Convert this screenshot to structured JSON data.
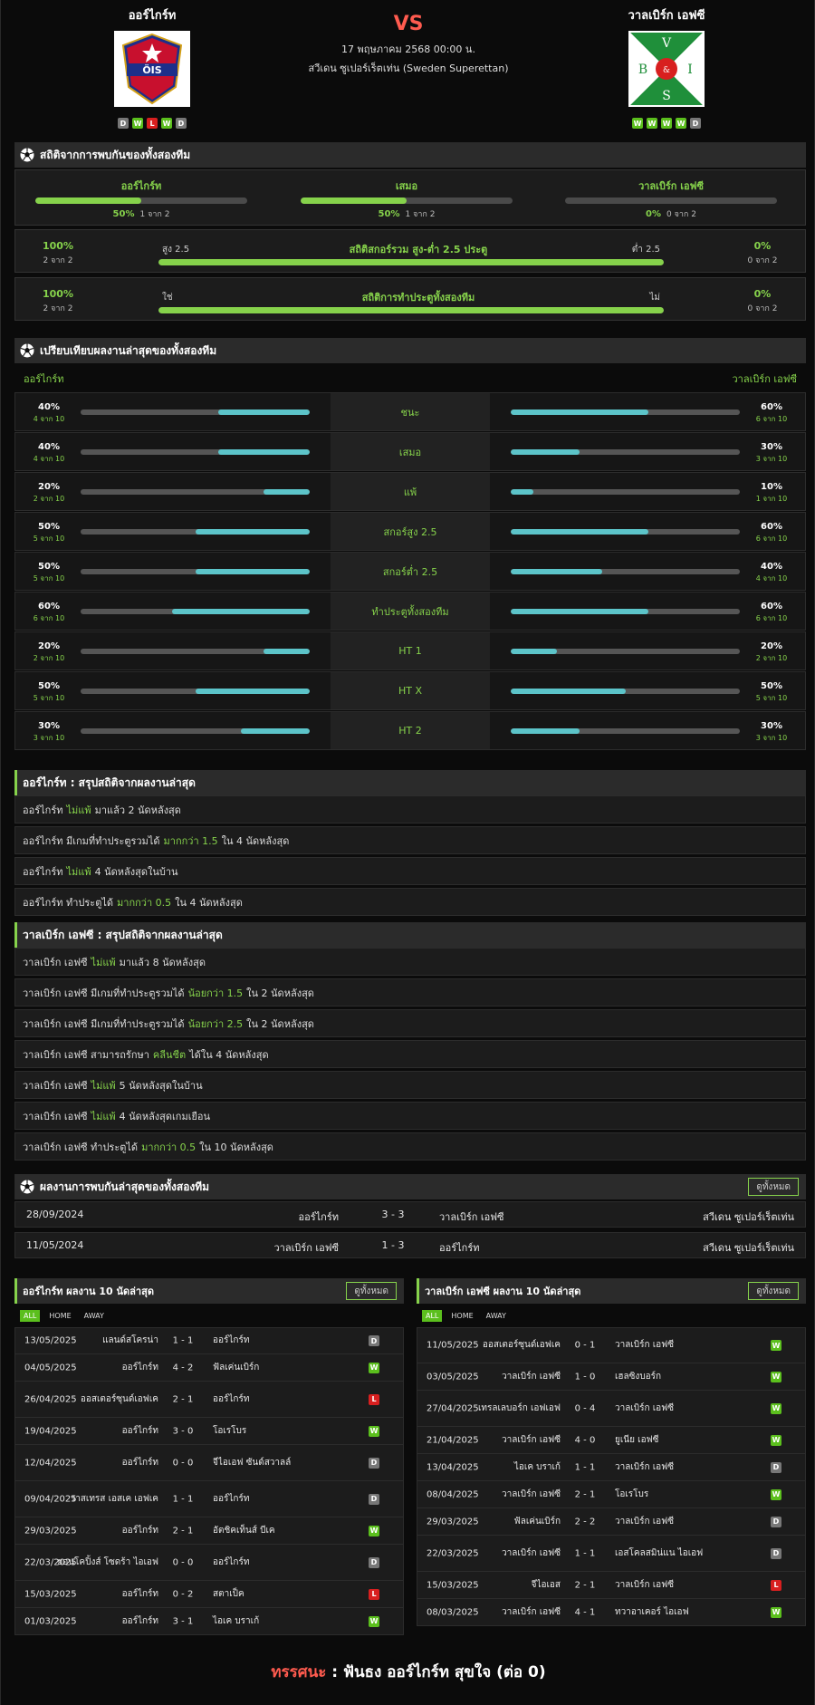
{
  "header": {
    "home_team": "ออร์ไกร์ท",
    "away_team": "วาลเบิร์ก เอฟซี",
    "vs": "VS",
    "date": "17 พฤษภาคม 2568 00:00 น.",
    "league": "สวีเดน ซูเปอร์เร็ตเท่น (Sweden Superettan)",
    "home_logo_text": "ÖIS",
    "away_logo_letters": [
      "V",
      "B",
      "&",
      "I",
      "S"
    ],
    "home_form": [
      "D",
      "W",
      "L",
      "W",
      "D"
    ],
    "away_form": [
      "W",
      "W",
      "W",
      "W",
      "D"
    ]
  },
  "h2h_stats": {
    "title": "สถิติจากการพบกันของทั้งสองทีม",
    "cells": [
      {
        "label": "ออร์ไกร์ท",
        "pct": "50%",
        "count": "1 จาก 2",
        "fill": 0.5
      },
      {
        "label": "เสมอ",
        "pct": "50%",
        "count": "1 จาก 2",
        "fill": 0.5
      },
      {
        "label": "วาลเบิร์ก เอฟซี",
        "pct": "0%",
        "count": "0 จาก 2",
        "fill": 0
      }
    ],
    "ou": {
      "title": "สถิติสกอร์รวม สูง-ต่ำ 2.5 ประตู",
      "left_label": "สูง 2.5",
      "right_label": "ต่ำ 2.5",
      "left_pct": "100%",
      "left_count": "2 จาก 2",
      "right_pct": "0%",
      "right_count": "0 จาก 2",
      "fill": 1
    },
    "btts": {
      "title": "สถิติการทำประตูทั้งสองทีม",
      "left_label": "ใช่",
      "right_label": "ไม่",
      "left_pct": "100%",
      "left_count": "2 จาก 2",
      "right_pct": "0%",
      "right_count": "0 จาก 2",
      "fill": 1
    }
  },
  "compare": {
    "title": "เปรียบเทียบผลงานล่าสุดของทั้งสองทีม",
    "home": "ออร์ไกร์ท",
    "away": "วาลเบิร์ก เอฟซี",
    "rows": [
      {
        "label": "ชนะ",
        "hp": "40%",
        "hc": "4 จาก 10",
        "hf": 0.4,
        "ap": "60%",
        "ac": "6 จาก 10",
        "af": 0.6
      },
      {
        "label": "เสมอ",
        "hp": "40%",
        "hc": "4 จาก 10",
        "hf": 0.4,
        "ap": "30%",
        "ac": "3 จาก 10",
        "af": 0.3
      },
      {
        "label": "แพ้",
        "hp": "20%",
        "hc": "2 จาก 10",
        "hf": 0.2,
        "ap": "10%",
        "ac": "1 จาก 10",
        "af": 0.1
      },
      {
        "label": "สกอร์สูง 2.5",
        "hp": "50%",
        "hc": "5 จาก 10",
        "hf": 0.5,
        "ap": "60%",
        "ac": "6 จาก 10",
        "af": 0.6
      },
      {
        "label": "สกอร์ต่ำ 2.5",
        "hp": "50%",
        "hc": "5 จาก 10",
        "hf": 0.5,
        "ap": "40%",
        "ac": "4 จาก 10",
        "af": 0.4
      },
      {
        "label": "ทำประตูทั้งสองทีม",
        "hp": "60%",
        "hc": "6 จาก 10",
        "hf": 0.6,
        "ap": "60%",
        "ac": "6 จาก 10",
        "af": 0.6
      },
      {
        "label": "HT 1",
        "hp": "20%",
        "hc": "2 จาก 10",
        "hf": 0.2,
        "ap": "20%",
        "ac": "2 จาก 10",
        "af": 0.2
      },
      {
        "label": "HT X",
        "hp": "50%",
        "hc": "5 จาก 10",
        "hf": 0.5,
        "ap": "50%",
        "ac": "5 จาก 10",
        "af": 0.5
      },
      {
        "label": "HT 2",
        "hp": "30%",
        "hc": "3 จาก 10",
        "hf": 0.3,
        "ap": "30%",
        "ac": "3 จาก 10",
        "af": 0.3
      }
    ]
  },
  "home_summary": {
    "title": "ออร์ไกร์ท : สรุปสถิติจากผลงานล่าสุด",
    "rows": [
      [
        "ออร์ไกร์ท",
        "ไม่แพ้",
        "มาแล้ว 2 นัดหลังสุด"
      ],
      [
        "ออร์ไกร์ท มีเกมที่ทำประตูรวมได้",
        "มากกว่า 1.5",
        "ใน 4 นัดหลังสุด"
      ],
      [
        "ออร์ไกร์ท",
        "ไม่แพ้",
        "4 นัดหลังสุดในบ้าน"
      ],
      [
        "ออร์ไกร์ท ทำประตูได้",
        "มากกว่า 0.5",
        "ใน 4 นัดหลังสุด"
      ]
    ]
  },
  "away_summary": {
    "title": "วาลเบิร์ก เอฟซี : สรุปสถิติจากผลงานล่าสุด",
    "rows": [
      [
        "วาลเบิร์ก เอฟซี",
        "ไม่แพ้",
        "มาแล้ว 8 นัดหลังสุด"
      ],
      [
        "วาลเบิร์ก เอฟซี มีเกมที่ทำประตูรวมได้",
        "น้อยกว่า 1.5",
        "ใน 2 นัดหลังสุด"
      ],
      [
        "วาลเบิร์ก เอฟซี มีเกมที่ทำประตูรวมได้",
        "น้อยกว่า 2.5",
        "ใน 2 นัดหลังสุด"
      ],
      [
        "วาลเบิร์ก เอฟซี สามารถรักษา",
        "คลีนชีต",
        "ได้ใน 4 นัดหลังสุด"
      ],
      [
        "วาลเบิร์ก เอฟซี",
        "ไม่แพ้",
        "5 นัดหลังสุดในบ้าน"
      ],
      [
        "วาลเบิร์ก เอฟซี",
        "ไม่แพ้",
        "4 นัดหลังสุดเกมเยือน"
      ],
      [
        "วาลเบิร์ก เอฟซี ทำประตูได้",
        "มากกว่า 0.5",
        "ใน 10 นัดหลังสุด"
      ]
    ]
  },
  "h2h_results": {
    "title": "ผลงานการพบกันล่าสุดของทั้งสองทีม",
    "view_all": "ดูทั้งหมด",
    "rows": [
      {
        "date": "28/09/2024",
        "home": "ออร์ไกร์ท",
        "score": "3 - 3",
        "away": "วาลเบิร์ก เอฟซี",
        "league": "สวีเดน ซูเปอร์เร็ตเท่น"
      },
      {
        "date": "11/05/2024",
        "home": "วาลเบิร์ก เอฟซี",
        "score": "1 - 3",
        "away": "ออร์ไกร์ท",
        "league": "สวีเดน ซูเปอร์เร็ตเท่น"
      }
    ]
  },
  "tabs": [
    "ALL",
    "HOME",
    "AWAY"
  ],
  "home_last10": {
    "title": "ออร์ไกร์ท ผลงาน 10 นัดล่าสุด",
    "view_all": "ดูทั้งหมด",
    "rows": [
      {
        "date": "13/05/2025",
        "home": "แลนด์สโครน่า",
        "score": "1 - 1",
        "away": "ออร์ไกร์ท",
        "r": "D"
      },
      {
        "date": "04/05/2025",
        "home": "ออร์ไกร์ท",
        "score": "4 - 2",
        "away": "ฟัลเค่นเบิร์ก",
        "r": "W"
      },
      {
        "date": "26/04/2025",
        "home": "ออสเตอร์ซุนด์เอฟเค",
        "score": "2 - 1",
        "away": "ออร์ไกร์ท",
        "r": "L"
      },
      {
        "date": "19/04/2025",
        "home": "ออร์ไกร์ท",
        "score": "3 - 0",
        "away": "โอเรโบร",
        "r": "W"
      },
      {
        "date": "12/04/2025",
        "home": "ออร์ไกร์ท",
        "score": "0 - 0",
        "away": "จีไอเอฟ ซันด์สวาลล์",
        "r": "D"
      },
      {
        "date": "09/04/2025",
        "home": "วาสเทรส เอสเค เอฟเค",
        "score": "1 - 1",
        "away": "ออร์ไกร์ท",
        "r": "D"
      },
      {
        "date": "29/03/2025",
        "home": "ออร์ไกร์ท",
        "score": "2 - 1",
        "away": "อัตชิคเท็นส์ บีเค",
        "r": "W"
      },
      {
        "date": "22/03/2025",
        "home": "ยอนโคปิ้งส์ โซดร้า ไอเอฟ",
        "score": "0 - 0",
        "away": "ออร์ไกร์ท",
        "r": "D"
      },
      {
        "date": "15/03/2025",
        "home": "ออร์ไกร์ท",
        "score": "0 - 2",
        "away": "สตาเป็ค",
        "r": "L"
      },
      {
        "date": "01/03/2025",
        "home": "ออร์ไกร์ท",
        "score": "3 - 1",
        "away": "ไอเค บราเก้",
        "r": "W"
      }
    ]
  },
  "away_last10": {
    "title": "วาลเบิร์ก เอฟซี ผลงาน 10 นัดล่าสุด",
    "view_all": "ดูทั้งหมด",
    "rows": [
      {
        "date": "11/05/2025",
        "home": "ออสเตอร์ซุนด์เอฟเค",
        "score": "0 - 1",
        "away": "วาลเบิร์ก เอฟซี",
        "r": "W"
      },
      {
        "date": "03/05/2025",
        "home": "วาลเบิร์ก เอฟซี",
        "score": "1 - 0",
        "away": "เฮลซิงบอร์ก",
        "r": "W"
      },
      {
        "date": "27/04/2025",
        "home": "เทรลเลบอร์ก เอฟเอฟ",
        "score": "0 - 4",
        "away": "วาลเบิร์ก เอฟซี",
        "r": "W"
      },
      {
        "date": "21/04/2025",
        "home": "วาลเบิร์ก เอฟซี",
        "score": "4 - 0",
        "away": "ยูเนีย เอฟซี",
        "r": "W"
      },
      {
        "date": "13/04/2025",
        "home": "ไอเค บราเก้",
        "score": "1 - 1",
        "away": "วาลเบิร์ก เอฟซี",
        "r": "D"
      },
      {
        "date": "08/04/2025",
        "home": "วาลเบิร์ก เอฟซี",
        "score": "2 - 1",
        "away": "โอเรโบร",
        "r": "W"
      },
      {
        "date": "29/03/2025",
        "home": "ฟัลเค่นเบิร์ก",
        "score": "2 - 2",
        "away": "วาลเบิร์ก เอฟซี",
        "r": "D"
      },
      {
        "date": "22/03/2025",
        "home": "วาลเบิร์ก เอฟซี",
        "score": "1 - 1",
        "away": "เอสโคลสมิน่แน ไอเอฟ",
        "r": "D"
      },
      {
        "date": "15/03/2025",
        "home": "จีไอเอส",
        "score": "2 - 1",
        "away": "วาลเบิร์ก เอฟซี",
        "r": "L"
      },
      {
        "date": "08/03/2025",
        "home": "วาลเบิร์ก เอฟซี",
        "score": "4 - 1",
        "away": "ทวาอาเคอร์ ไอเอฟ",
        "r": "W"
      }
    ]
  },
  "verdict": {
    "label": "ทรรศนะ",
    "sep": ":",
    "text": "ฟันธง ออร์ไกร์ท สุขใจ (ต่อ 0)"
  }
}
